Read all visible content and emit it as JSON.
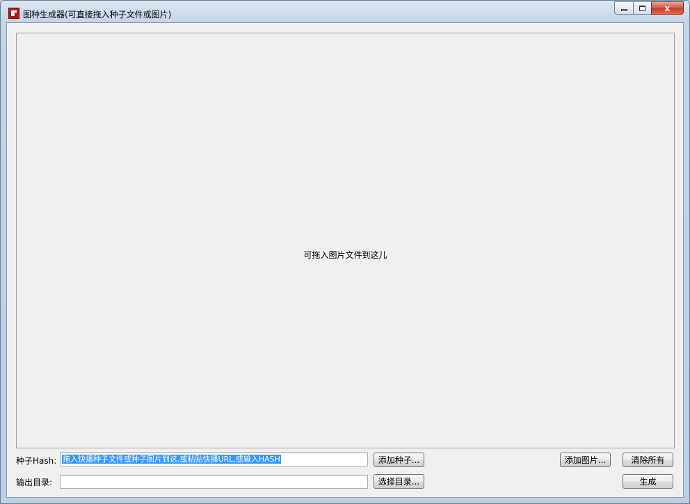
{
  "window": {
    "title": "图种生成器(可直接拖入种子文件或图片)",
    "icon": "app-icon"
  },
  "caption_buttons": {
    "minimize": "minimize-icon",
    "maximize": "maximize-icon",
    "close": "close-icon",
    "close_glyph": "x"
  },
  "drop_area": {
    "hint": "可拖入图片文件到这儿"
  },
  "seed": {
    "label": "种子Hash:",
    "value": "拖入快播种子文件或种子图片到这,或粘贴快播URL,或输入HASH",
    "add_button": "添加种子..."
  },
  "output": {
    "label": "输出目录:",
    "value": "",
    "select_button": "选择目录..."
  },
  "actions": {
    "add_image": "添加图片...",
    "clear_all": "清除所有",
    "generate": "生成"
  },
  "colors": {
    "selection": "#3399ff",
    "client_bg": "#f0f0f0",
    "close_button": "#c73f2f"
  }
}
